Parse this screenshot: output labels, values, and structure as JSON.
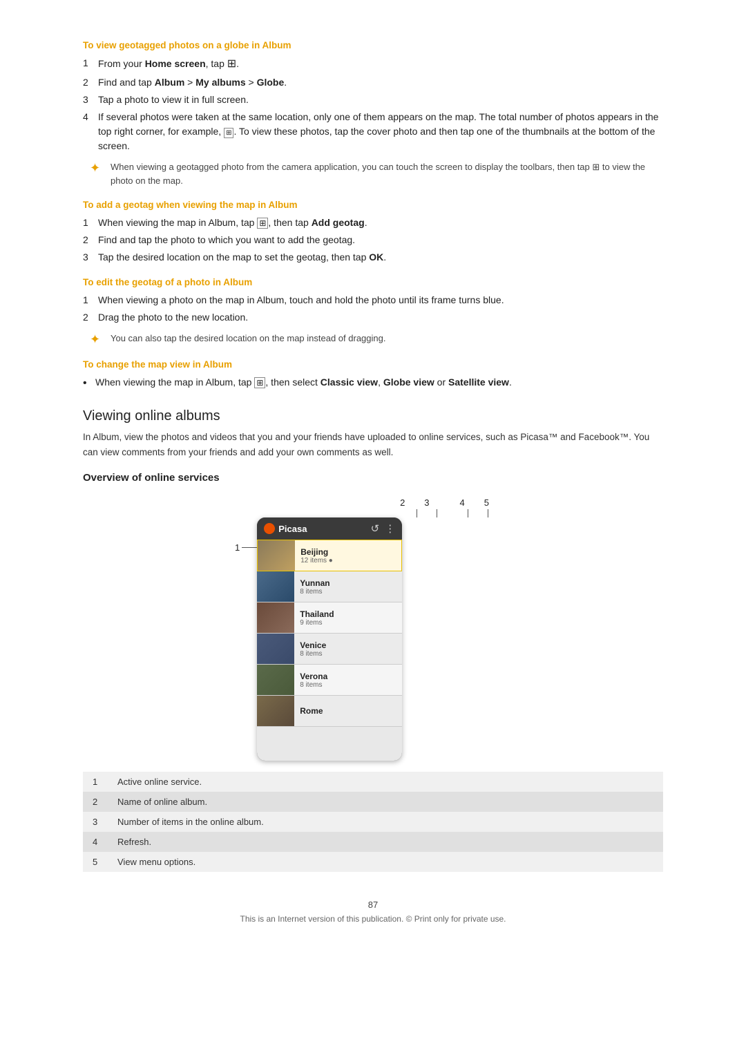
{
  "headings": {
    "view_geotagged": "To view geotagged photos on a globe in Album",
    "add_geotag": "To add a geotag when viewing the map in Album",
    "edit_geotag": "To edit the geotag of a photo in Album",
    "change_map_view": "To change the map view in Album",
    "viewing_online_albums": "Viewing online albums",
    "overview_online_services": "Overview of online services"
  },
  "steps_view_geotagged": [
    {
      "num": "1",
      "text": "From your Home screen, tap ⊞."
    },
    {
      "num": "2",
      "text": "Find and tap Album > My albums > Globe."
    },
    {
      "num": "3",
      "text": "Tap a photo to view it in full screen."
    },
    {
      "num": "4",
      "text": "If several photos were taken at the same location, only one of them appears on the map. The total number of photos appears in the top right corner, for example, ⊞. To view these photos, tap the cover photo and then tap one of the thumbnails at the bottom of the screen."
    }
  ],
  "tip1": "When viewing a geotagged photo from the camera application, you can touch the screen to display the toolbars, then tap ⊞ to view the photo on the map.",
  "steps_add_geotag": [
    {
      "num": "1",
      "text": "When viewing the map in Album, tap ⊞, then tap Add geotag."
    },
    {
      "num": "2",
      "text": "Find and tap the photo to which you want to add the geotag."
    },
    {
      "num": "3",
      "text": "Tap the desired location on the map to set the geotag, then tap OK."
    }
  ],
  "steps_edit_geotag": [
    {
      "num": "1",
      "text": "When viewing a photo on the map in Album, touch and hold the photo until its frame turns blue."
    },
    {
      "num": "2",
      "text": "Drag the photo to the new location."
    }
  ],
  "tip2": "You can also tap the desired location on the map instead of dragging.",
  "bullet_change_map": "When viewing the map in Album, tap ⊞, then select Classic view, Globe view or Satellite view.",
  "body_online_albums": "In Album, view the photos and videos that you and your friends have uploaded to online services, such as Picasa™ and Facebook™. You can view comments from your friends and add your own comments as well.",
  "callout_numbers": [
    "2",
    "3",
    "4",
    "5"
  ],
  "callout_left_num": "1",
  "albums": [
    {
      "name": "Beijing",
      "count": "12 items",
      "style": "beijing",
      "highlight": true
    },
    {
      "name": "Yunnan",
      "count": "8 items",
      "style": "yunnan",
      "highlight": false
    },
    {
      "name": "Thailand",
      "count": "9 items",
      "style": "thailand",
      "highlight": false
    },
    {
      "name": "Venice",
      "count": "8 items",
      "style": "venice",
      "highlight": false
    },
    {
      "name": "Verona",
      "count": "8 items",
      "style": "verona",
      "highlight": false
    },
    {
      "name": "Rome",
      "count": "",
      "style": "rome",
      "highlight": false
    }
  ],
  "picasa_label": "Picasa",
  "legend": [
    {
      "num": "1",
      "text": "Active online service."
    },
    {
      "num": "2",
      "text": "Name of online album."
    },
    {
      "num": "3",
      "text": "Number of items in the online album."
    },
    {
      "num": "4",
      "text": "Refresh."
    },
    {
      "num": "5",
      "text": "View menu options."
    }
  ],
  "page_number": "87",
  "footer_text": "This is an Internet version of this publication. © Print only for private use."
}
